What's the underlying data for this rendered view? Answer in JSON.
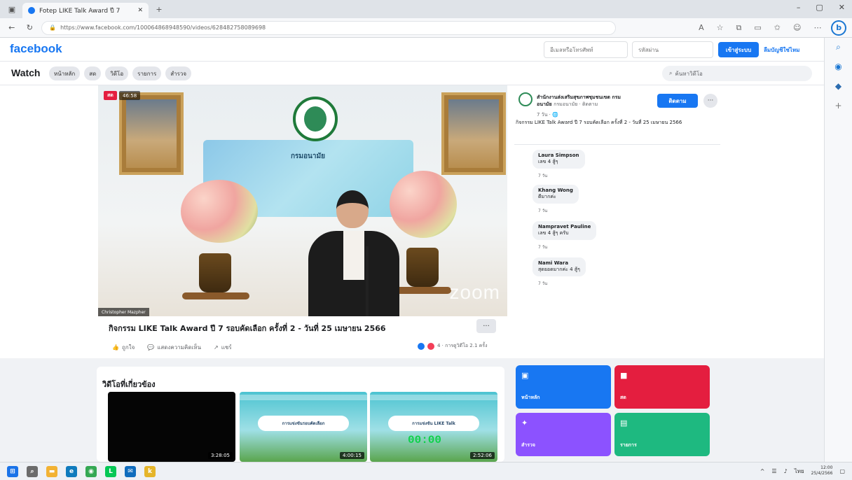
{
  "browser": {
    "tab_title": "Fotep LIKE Talk Award ปี 7",
    "url": "https://www.facebook.com/100064868948590/videos/628482758089698",
    "window_controls": [
      "–",
      "▢",
      "✕"
    ],
    "new_tab": "+"
  },
  "fb": {
    "logo": "facebook",
    "login": {
      "email_placeholder": "อีเมลหรือโทรศัพท์",
      "password_placeholder": "รหัสผ่าน",
      "login_button": "เข้าสู่ระบบ",
      "signup_link": "ลืมบัญชีใช่ไหม"
    }
  },
  "watch": {
    "title": "Watch",
    "tabs": [
      "หน้าหลัก",
      "สด",
      "วิดีโอ",
      "รายการ",
      "สำรวจ"
    ],
    "search_placeholder": "ค้นหาวิดีโอ"
  },
  "video": {
    "live_badge": "สด",
    "view_badge": "46:58",
    "dept_label": "กรมอนามัย",
    "zoom_watermark": "zoom",
    "name_tag": "Christopher Mazpher",
    "title": "กิจกรรม LIKE Talk Award ปี 7 รอบคัดเลือก ครั้งที่ 2 - วันที่ 25 เมษายน 2566",
    "more": "···",
    "actions": [
      {
        "icon": "like-icon",
        "glyph": "👍",
        "label": "ถูกใจ"
      },
      {
        "icon": "comment-icon",
        "glyph": "💬",
        "label": "แสดงความคิดเห็น"
      },
      {
        "icon": "share-icon",
        "glyph": "↗",
        "label": "แชร์"
      }
    ],
    "reactions_text": "4 · การดูวิดีโอ 2.1 ครั้ง",
    "reaction_colors": [
      "#1877f2",
      "#f33e58"
    ]
  },
  "panel": {
    "page_name": "สำนักงานส่งเสริมสุขภาพชุมชนเขต กรมอนามัย",
    "page_sub": "กรมอนามัย · ติดตาม",
    "post_time": "7 วัน · 🌐",
    "follow_button": "ติดตาม",
    "more": "···",
    "description": "กิจกรรม LIKE Talk Award ปี 7 รอบคัดเลือก ครั้งที่ 2 - วันที่ 25 เมษายน 2566",
    "comments": [
      {
        "name": "Laura Simpson",
        "text": "เลข 4 สู้ๆ",
        "time": "7 วัน",
        "color": "#8b5e3c"
      },
      {
        "name": "Khang Wong",
        "text": "ดีมากค่ะ",
        "time": "7 วัน",
        "color": "#5f6b5a"
      },
      {
        "name": "Nampravet Pauline",
        "text": "เลข 4 สู้ๆ ครับ",
        "time": "7 วัน",
        "color": "#9aa3ad"
      },
      {
        "name": "Nami Wara",
        "text": "สุดยอดมากค่ะ 4 สู้ๆ",
        "time": "7 วัน",
        "color": "#3f5566"
      }
    ]
  },
  "related": {
    "title": "วิดีโอที่เกี่ยวข้อง",
    "videos": [
      {
        "style": "black",
        "pill": "",
        "counter": "",
        "duration": "3:28:05"
      },
      {
        "style": "teal",
        "pill": "การแข่งขันรอบคัดเลือก",
        "counter": "",
        "duration": "4:00:15"
      },
      {
        "style": "teal",
        "pill": "การแข่งขัน LIKE Talk",
        "counter": "00:00",
        "duration": "2:52:06"
      }
    ]
  },
  "tiles": [
    {
      "label": "หน้าหลัก",
      "icon": "home-icon",
      "glyph": "▣",
      "color": "#1877f2"
    },
    {
      "label": "สด",
      "icon": "live-icon",
      "glyph": "■",
      "color": "#e41e3f"
    },
    {
      "label": "สำรวจ",
      "icon": "explore-icon",
      "glyph": "✦",
      "color": "#8c52ff"
    },
    {
      "label": "รายการ",
      "icon": "shows-icon",
      "glyph": "▤",
      "color": "#1eb980"
    }
  ],
  "taskbar": {
    "time": "12:00",
    "date": "25/4/2566",
    "lang": "ไทย",
    "apps": [
      {
        "name": "start",
        "glyph": "⊞",
        "color": "#1a73e8"
      },
      {
        "name": "search",
        "glyph": "⌕",
        "color": "#6b6b6b"
      },
      {
        "name": "files",
        "glyph": "▬",
        "color": "#f2b233"
      },
      {
        "name": "edge",
        "glyph": "e",
        "color": "#0f7bbd"
      },
      {
        "name": "chrome",
        "glyph": "◉",
        "color": "#34a853"
      },
      {
        "name": "line",
        "glyph": "L",
        "color": "#06c755"
      },
      {
        "name": "outlook",
        "glyph": "✉",
        "color": "#0f6cbd"
      },
      {
        "name": "k-app",
        "glyph": "k",
        "color": "#e5b52a"
      }
    ]
  }
}
